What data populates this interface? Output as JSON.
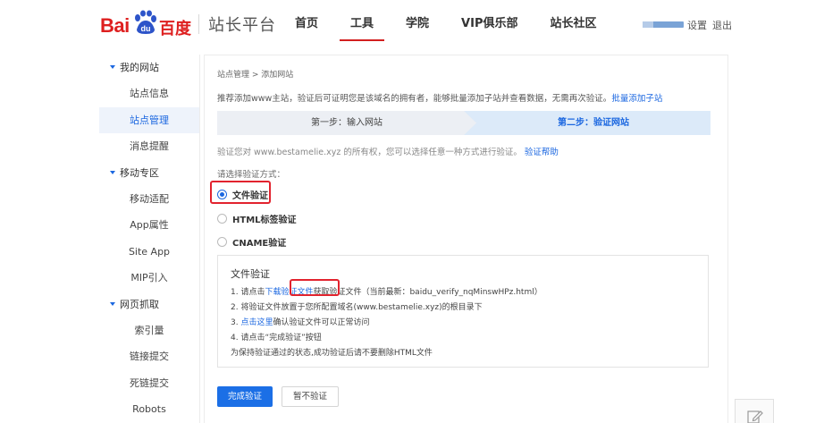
{
  "header": {
    "logo_bai": "Bai",
    "logo_du": "du",
    "logo_cn": "百度",
    "platform": "站长平台",
    "nav": [
      {
        "label": "首页",
        "active": false
      },
      {
        "label": "工具",
        "active": true
      },
      {
        "label": "学院",
        "active": false
      },
      {
        "label": "VIP俱乐部",
        "active": false
      },
      {
        "label": "站长社区",
        "active": false
      }
    ],
    "settings": "设置",
    "logout": "退出"
  },
  "sidebar": {
    "groups": [
      {
        "label": "我的网站",
        "items": [
          "站点信息",
          "站点管理",
          "消息提醒"
        ]
      },
      {
        "label": "移动专区",
        "items": [
          "移动适配",
          "App属性",
          "Site App",
          "MIP引入"
        ]
      },
      {
        "label": "网页抓取",
        "items": [
          "索引量",
          "链接提交",
          "死链提交",
          "Robots"
        ]
      }
    ],
    "active_item": "站点管理"
  },
  "main": {
    "breadcrumb": "站点管理 > 添加网站",
    "tip": "推荐添加www主站，验证后可证明您是该域名的拥有者，能够批量添加子站并查看数据，无需再次验证。",
    "tip_link": "批量添加子站",
    "step1": "第一步：输入网站",
    "step2": "第二步：验证网站",
    "verify_text": "验证您对 www.bestamelie.xyz 的所有权，您可以选择任意一种方式进行验证。",
    "verify_help": "验证帮助",
    "choose_label": "请选择验证方式：",
    "options": [
      {
        "label": "文件验证",
        "checked": true
      },
      {
        "label": "HTML标签验证",
        "checked": false
      },
      {
        "label": "CNAME验证",
        "checked": false
      }
    ],
    "infobox": {
      "title": "文件验证",
      "line1_pre": "1. 请点击",
      "line1_link": "下载验证文件",
      "line1_post": "获取验证文件（当前最新：baidu_verify_nqMinswHPz.html）",
      "line2": "2. 将验证文件放置于您所配置域名(www.bestamelie.xyz)的根目录下",
      "line3_link": "点击这里",
      "line3_pre": "3. ",
      "line3_post": "确认验证文件可以正常访问",
      "line4": "4. 请点击“完成验证”按钮",
      "note": "为保持验证通过的状态,成功验证后请不要删除HTML文件"
    },
    "btn_complete": "完成验证",
    "btn_skip": "暂不验证"
  },
  "colors": {
    "brand_red": "#de1f1f",
    "link_blue": "#1b67e0",
    "highlight_red": "#e2232e"
  },
  "icons": [
    "baidu-paw-icon",
    "triangle-down-icon",
    "radio-icon",
    "edit-feedback-icon"
  ]
}
